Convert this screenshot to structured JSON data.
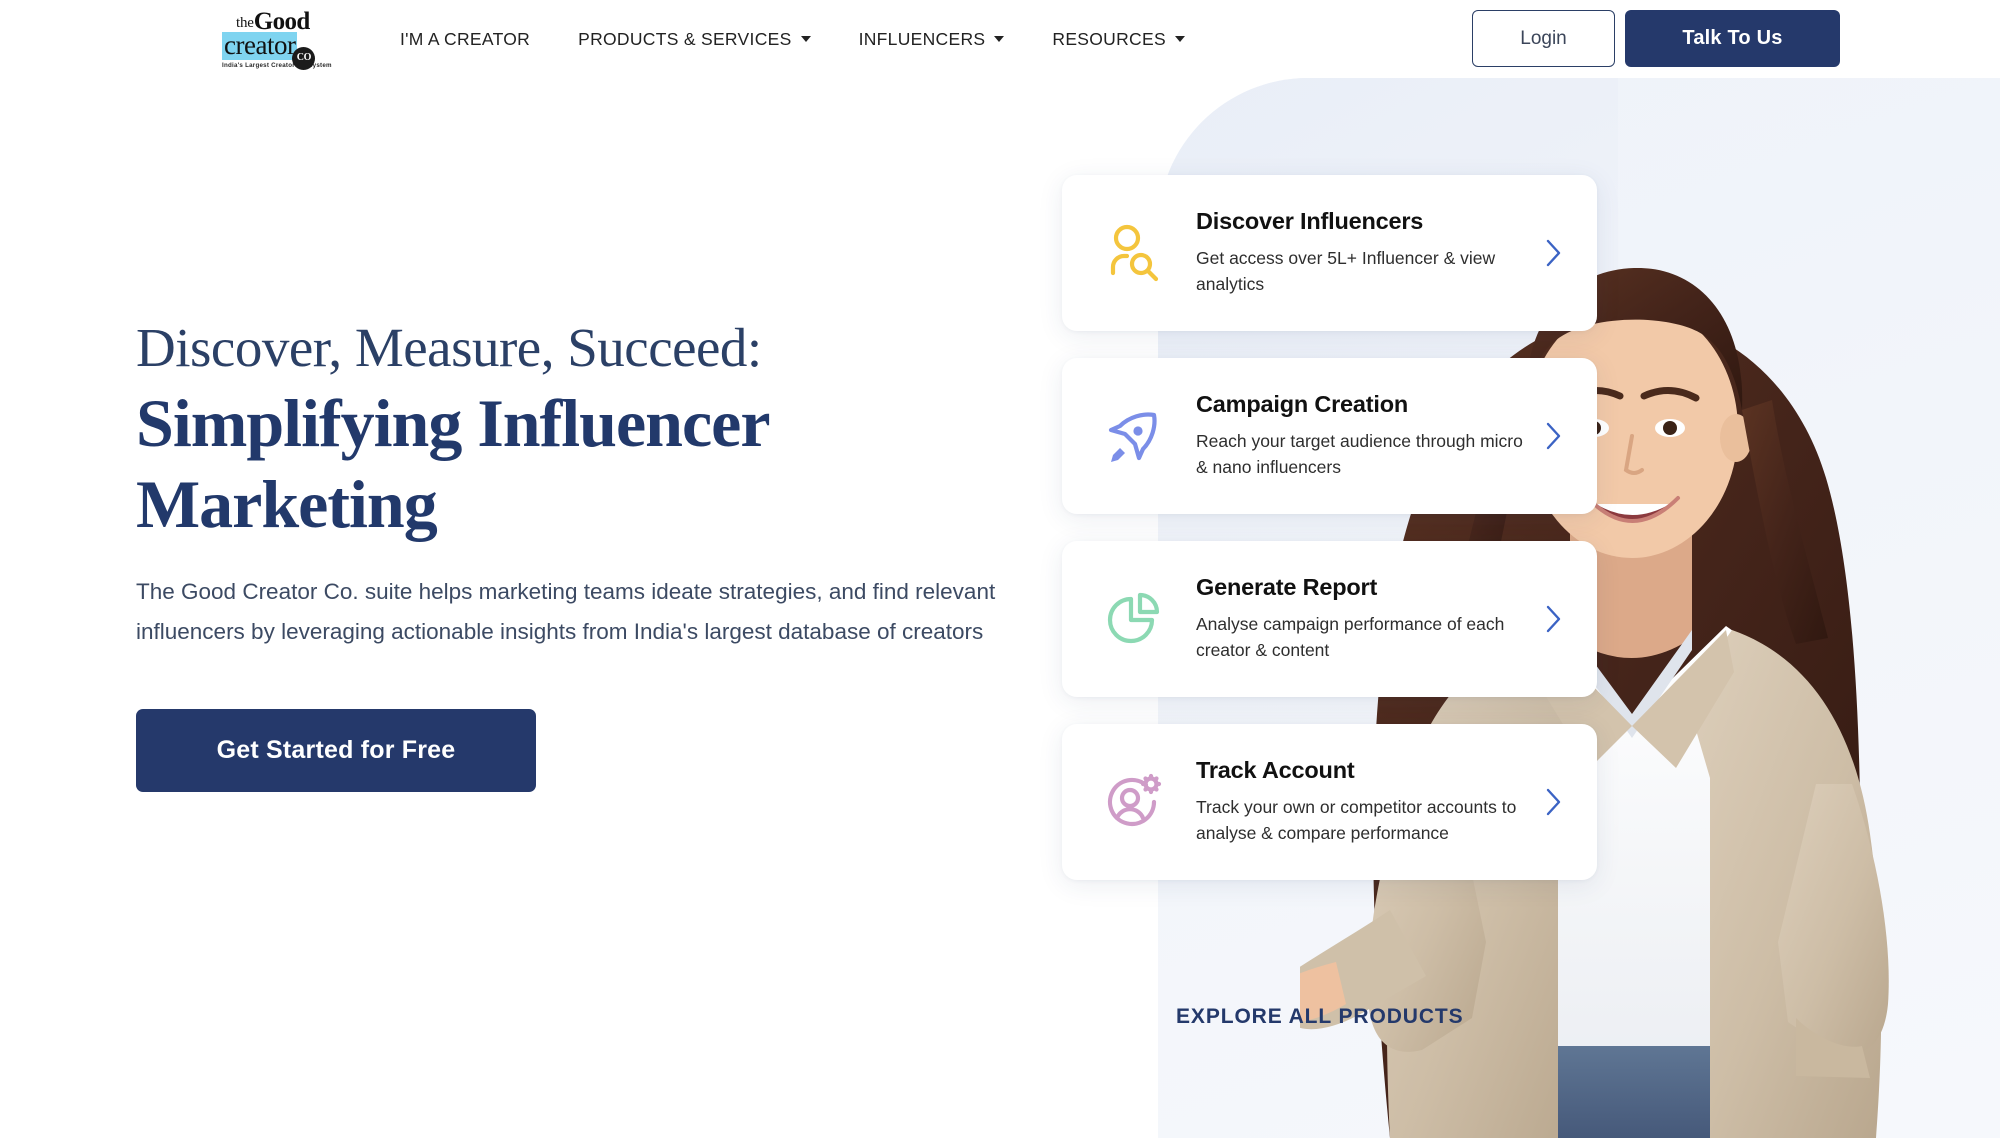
{
  "brand": {
    "logo_the": "the",
    "logo_good": "Good",
    "logo_creator": "creator",
    "logo_co": "CO",
    "logo_tagline": "India's Largest Creator Ecosystem",
    "navy": "#25396b",
    "accent_blue": "#3b63c4",
    "panel_bg": "#eef2f9"
  },
  "header": {
    "nav": [
      {
        "label": "I'M A CREATOR",
        "has_caret": false
      },
      {
        "label": "PRODUCTS & SERVICES",
        "has_caret": true
      },
      {
        "label": "INFLUENCERS",
        "has_caret": true
      },
      {
        "label": "RESOURCES",
        "has_caret": true
      }
    ],
    "login_label": "Login",
    "talk_label": "Talk To Us"
  },
  "hero": {
    "eyebrow": "Discover, Measure, Succeed:",
    "title": "Simplifying Influencer Marketing",
    "subtitle": "The Good Creator Co. suite helps marketing teams ideate strategies, and find relevant influencers by leveraging actionable insights from India's largest database of creators",
    "cta_label": "Get Started for Free"
  },
  "cards": [
    {
      "icon": "user-search-icon",
      "icon_color": "#f4c53d",
      "title": "Discover Influencers",
      "desc": "Get access over 5L+ Influencer & view analytics"
    },
    {
      "icon": "rocket-icon",
      "icon_color": "#7b8ee8",
      "title": "Campaign Creation",
      "desc": "Reach your target audience through micro & nano influencers"
    },
    {
      "icon": "pie-chart-icon",
      "icon_color": "#8cd9b3",
      "title": "Generate Report",
      "desc": "Analyse campaign performance of each creator & content"
    },
    {
      "icon": "user-settings-icon",
      "icon_color": "#cf9cc8",
      "title": "Track Account",
      "desc": "Track your own or competitor accounts to analyse & compare performance"
    }
  ],
  "explore_label": "EXPLORE ALL PRODUCTS"
}
